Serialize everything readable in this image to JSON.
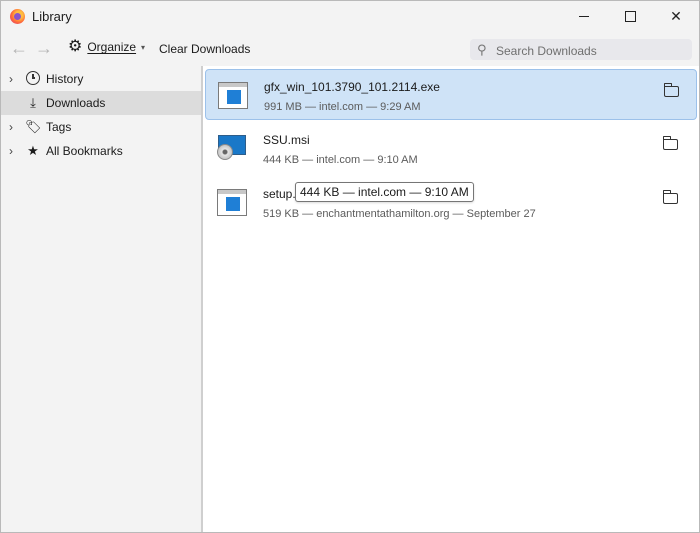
{
  "window": {
    "title": "Library",
    "controls": {
      "minimize": "minimize",
      "maximize": "maximize",
      "close": "✕"
    }
  },
  "toolbar": {
    "back_icon": "arrow-left-icon",
    "forward_icon": "arrow-right-icon",
    "organize_label": "Organize",
    "clear_label": "Clear Downloads",
    "search_placeholder": "Search Downloads"
  },
  "sidebar": {
    "items": [
      {
        "label": "History",
        "icon": "clock-icon",
        "expandable": true,
        "selected": false
      },
      {
        "label": "Downloads",
        "icon": "download-icon",
        "expandable": false,
        "selected": true
      },
      {
        "label": "Tags",
        "icon": "tag-icon",
        "expandable": true,
        "selected": false
      },
      {
        "label": "All Bookmarks",
        "icon": "star-icon",
        "expandable": true,
        "selected": false
      }
    ]
  },
  "downloads": [
    {
      "name": "gfx_win_101.3790_101.2114.exe",
      "meta": "991 MB — intel.com — 9:29 AM",
      "type": "exe",
      "selected": true
    },
    {
      "name": "SSU.msi",
      "meta": "444 KB — intel.com — 9:10 AM",
      "type": "msi",
      "selected": false
    },
    {
      "name": "setup.",
      "meta": "519 KB — enchantmentathamilton.org — September 27",
      "type": "exe",
      "selected": false
    }
  ],
  "tooltip": {
    "text": "444 KB — intel.com — 9:10 AM"
  },
  "colors": {
    "selection_bg": "#cfe3f7",
    "selection_border": "#9cc1ea",
    "accent": "#1f7fd6"
  }
}
